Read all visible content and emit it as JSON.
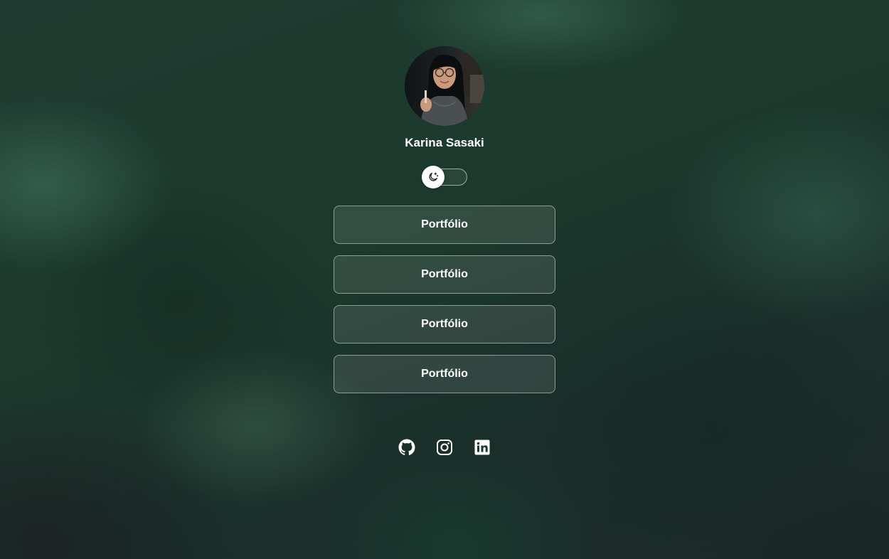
{
  "profile": {
    "name": "Karina Sasaki",
    "avatar_icon": "person-photo-avatar"
  },
  "theme_toggle": {
    "icon": "moon-stars-icon",
    "state": "off"
  },
  "links": [
    {
      "label": "Portfólio"
    },
    {
      "label": "Portfólio"
    },
    {
      "label": "Portfólio"
    },
    {
      "label": "Portfólio"
    }
  ],
  "socials": [
    {
      "icon": "github-icon"
    },
    {
      "icon": "instagram-icon"
    },
    {
      "icon": "linkedin-icon"
    }
  ],
  "colors": {
    "background": "#1c3a2f",
    "text": "#ffffff",
    "button_bg": "rgba(255,255,255,0.1)",
    "button_border": "rgba(255,255,255,0.45)"
  }
}
